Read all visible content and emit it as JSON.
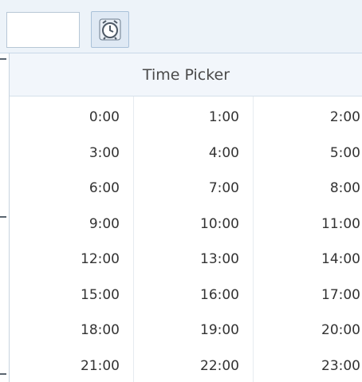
{
  "picker": {
    "title": "Time Picker",
    "times": [
      "0:00",
      "1:00",
      "2:00",
      "3:00",
      "4:00",
      "5:00",
      "6:00",
      "7:00",
      "8:00",
      "9:00",
      "10:00",
      "11:00",
      "12:00",
      "13:00",
      "14:00",
      "15:00",
      "16:00",
      "17:00",
      "18:00",
      "19:00",
      "20:00",
      "21:00",
      "22:00",
      "23:00"
    ]
  },
  "input": {
    "value": ""
  },
  "icons": {
    "clock": "alarm-clock-icon"
  },
  "colors": {
    "header_bg": "#f2f6fb",
    "toolbar_bg": "#edf3f9",
    "text": "#333333"
  }
}
